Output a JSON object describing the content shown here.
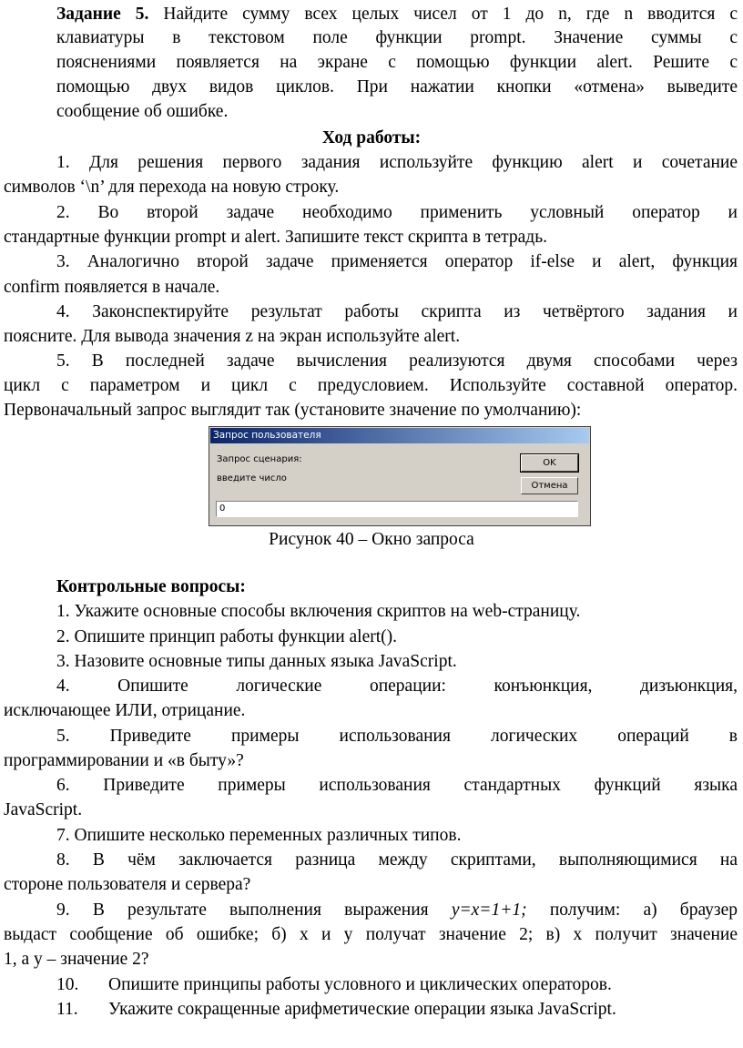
{
  "task": {
    "heading": "Задание 5.",
    "l1": "Найдите сумму всех целых чисел от 1 до n, где n вводится с",
    "l2": "клавиатуры в текстовом поле функции prompt. Значение суммы с",
    "l3": "пояснениями появляется на экране с помощью функции alert. Решите с",
    "l4": "помощью двух видов циклов. При нажатии кнопки «отмена» выведите",
    "l5": "сообщение об ошибке."
  },
  "workflow": {
    "title": "Ход работы:",
    "items": [
      {
        "l1": "1. Для решения первого задания используйте функцию alert и сочетание",
        "l2": "символов ‘\\n’ для перехода на новую строку."
      },
      {
        "l1": "2. Во второй задаче необходимо применить условный оператор и",
        "l2": "стандартные функции prompt и alert. Запишите текст скрипта в тетрадь."
      },
      {
        "l1": "3. Аналогично второй задаче применяется оператор if-else и alert, функция",
        "l2": "confirm появляется в начале."
      },
      {
        "l1": "4. Законспектируйте результат работы скрипта из четвёртого задания и",
        "l2": "поясните. Для вывода значения z на экран используйте alert."
      },
      {
        "l1": "5. В последней задаче вычисления реализуются двумя способами через",
        "l2": "цикл с параметром и цикл с предусловием. Используйте составной оператор.",
        "l3": "Первоначальный запрос выглядит так (установите значение по умолчанию):"
      }
    ]
  },
  "dialog": {
    "title": "Запрос пользователя",
    "prompt_label": "Запрос сценария:",
    "message": "введите число",
    "ok_label": "OK",
    "cancel_label": "Отмена",
    "input_value": "0"
  },
  "figure_caption": "Рисунок 40 – Окно запроса",
  "questions": {
    "title": "Контрольные вопросы:",
    "q1": "1. Укажите основные способы включения скриптов на web-страницу.",
    "q2": "2. Опишите принцип работы функции alert().",
    "q3": "3. Назовите основные типы данных языка JavaScript.",
    "q4_l1": "4. Опишите логические операции: конъюнкция, дизъюнкция,",
    "q4_l2": "исключающее ИЛИ, отрицание.",
    "q5_l1": "5. Приведите примеры использования логических операций в",
    "q5_l2": "программировании и «в быту»?",
    "q6_l1": "6. Приведите примеры использования стандартных функций языка",
    "q6_l2": "JavaScript.",
    "q7": "7. Опишите несколько переменных различных типов.",
    "q8_l1": "8. В чём заключается разница между скриптами, выполняющимися на",
    "q8_l2": "стороне пользователя и сервера?",
    "q9_a": "9. В результате выполнения выражения",
    "q9_expr": "y=x=1+1;",
    "q9_b": "получим: а) браузер",
    "q9_l2": "выдаст сообщение об ошибке; б) x и y получат значение 2; в) x получит значение",
    "q9_l3": "1, а y – значение 2?",
    "q10_num": "10.",
    "q10_text": "Опишите принципы работы условного и циклических операторов.",
    "q11_num": "11.",
    "q11_text": "Укажите сокращенные арифметические операции языка JavaScript."
  }
}
